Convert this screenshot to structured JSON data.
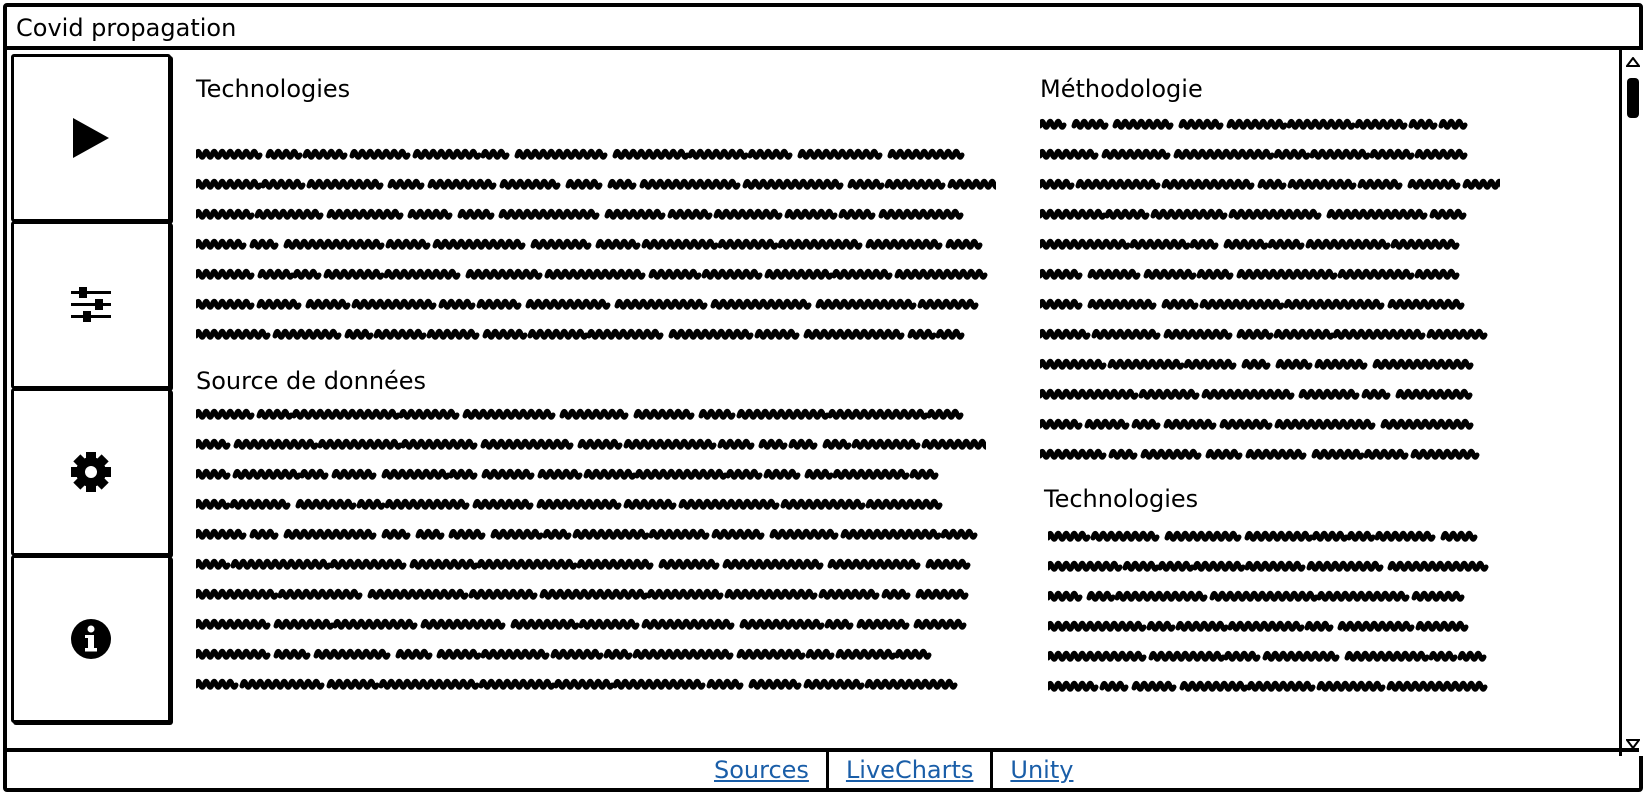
{
  "window": {
    "title": "Covid propagation"
  },
  "sidebar": {
    "buttons": [
      {
        "name": "play",
        "icon": "play-icon"
      },
      {
        "name": "settings-sliders",
        "icon": "sliders-icon"
      },
      {
        "name": "settings-gear",
        "icon": "gear-icon"
      },
      {
        "name": "info",
        "icon": "info-icon"
      }
    ]
  },
  "content": {
    "left": {
      "technologies_heading": "Technologies",
      "sources_heading": "Source de données"
    },
    "right": {
      "methodologie_heading": "Méthodologie",
      "technologies_heading": "Technologies"
    }
  },
  "footer": {
    "links": [
      "Sources",
      "LiveCharts",
      "Unity"
    ],
    "link_color": "#1a5ea8"
  }
}
